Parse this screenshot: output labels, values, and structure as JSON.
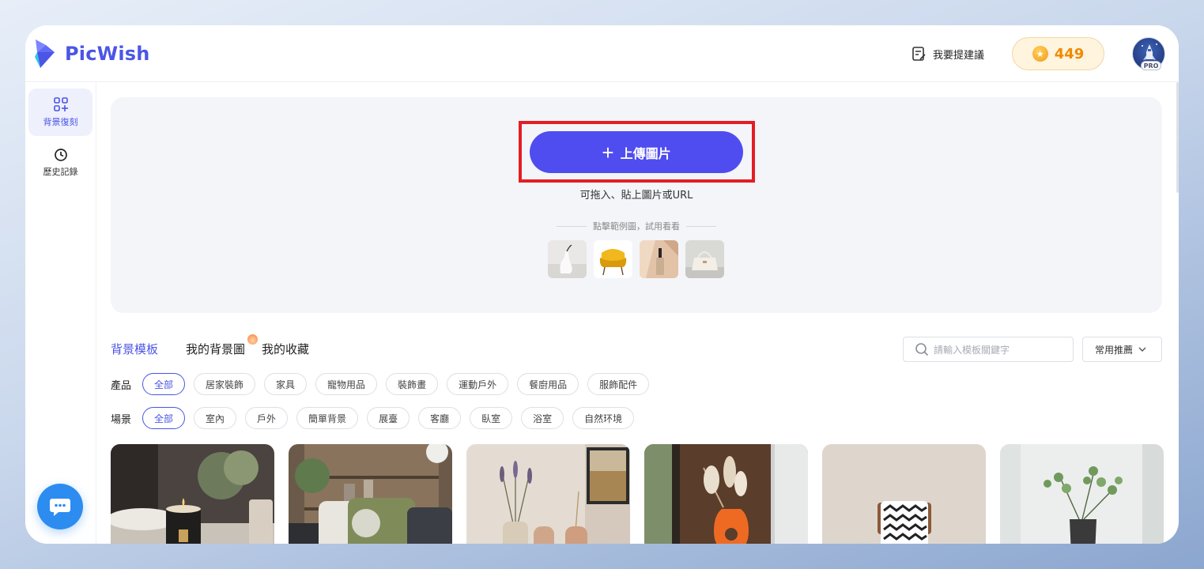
{
  "app": {
    "name": "PicWish",
    "brand_color": "#4b55e6"
  },
  "header": {
    "feedback_label": "我要提建議",
    "coins": "449",
    "avatar_badge": "PRO"
  },
  "sidebar": {
    "items": [
      {
        "label": "背景復刻",
        "icon": "grid-plus-icon",
        "active": true
      },
      {
        "label": "歷史記錄",
        "icon": "clock-icon",
        "active": false
      }
    ],
    "chat_icon": "chat-bubble-icon"
  },
  "upload": {
    "button_label": "上傳圖片",
    "hint": "可拖入、貼上圖片或URL",
    "sample_label": "點擊範例圖，試用看看",
    "samples": [
      "vase-sample",
      "yellow-chair-sample",
      "bottle-sample",
      "handbag-sample"
    ],
    "highlight_color": "#e31e24"
  },
  "tabs": [
    {
      "label": "背景模板",
      "active": true
    },
    {
      "label": "我的背景圖",
      "active": false
    },
    {
      "label": "我的收藏",
      "active": false
    }
  ],
  "search": {
    "placeholder": "請輸入模板關鍵字"
  },
  "sort": {
    "selected": "常用推薦"
  },
  "filters": {
    "product": {
      "label": "產品",
      "options": [
        "全部",
        "居家裝飾",
        "家具",
        "寵物用品",
        "裝飾畫",
        "運動戶外",
        "餐廚用品",
        "服飾配件"
      ],
      "active": 0
    },
    "scene": {
      "label": "場景",
      "options": [
        "全部",
        "室內",
        "戶外",
        "簡單背景",
        "展臺",
        "客廳",
        "臥室",
        "浴室",
        "自然环境"
      ],
      "active": 0
    }
  },
  "templates": [
    "candle-template",
    "pillow-shelf-template",
    "lavender-vase-template",
    "orange-vase-template",
    "cushion-template",
    "eucalyptus-template"
  ]
}
